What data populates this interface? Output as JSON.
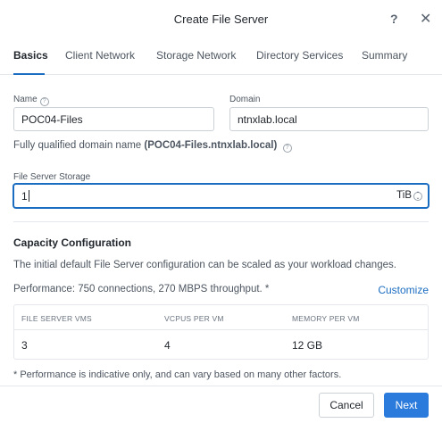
{
  "dialog": {
    "title": "Create File Server",
    "help_glyph": "?",
    "close_glyph": "✕"
  },
  "tabs": [
    {
      "label": "Basics",
      "active": true
    },
    {
      "label": "Client Network",
      "active": false
    },
    {
      "label": "Storage Network",
      "active": false
    },
    {
      "label": "Directory Services",
      "active": false
    },
    {
      "label": "Summary",
      "active": false
    }
  ],
  "form": {
    "name": {
      "label": "Name",
      "value": "POC04-Files",
      "icon": "info-icon"
    },
    "domain": {
      "label": "Domain",
      "value": "ntnxlab.local"
    },
    "fqdn": {
      "prefix": "Fully qualified domain name",
      "value": "(POC04-Files.ntnxlab.local)",
      "icon": "info-icon"
    },
    "storage": {
      "label": "File Server Storage",
      "value": "1",
      "unit": "TiB",
      "icon": "spinner-icon"
    }
  },
  "capacity": {
    "title": "Capacity Configuration",
    "description": "The initial default File Server configuration can be scaled as your workload changes.",
    "performance": "Performance: 750 connections, 270 MBPS throughput. *",
    "customize_label": "Customize",
    "table": {
      "headers": [
        "FILE SERVER VMS",
        "VCPUS PER VM",
        "MEMORY PER VM"
      ],
      "row": [
        "3",
        "4",
        "12 GB"
      ]
    },
    "footnote": "* Performance is indicative only, and can vary based on many other factors."
  },
  "footer": {
    "cancel_label": "Cancel",
    "next_label": "Next"
  },
  "colors": {
    "accent": "#1b6dc1",
    "primary_button": "#2a7bdc"
  }
}
